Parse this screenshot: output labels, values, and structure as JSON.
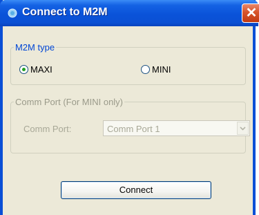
{
  "window": {
    "title": "Connect to M2M",
    "close_symbol": "✕",
    "title_icon": "app-icon"
  },
  "m2m_type": {
    "legend": "M2M type",
    "options": [
      {
        "label": "MAXI",
        "selected": true
      },
      {
        "label": "MINI",
        "selected": false
      }
    ]
  },
  "comm_port": {
    "legend": "Comm Port (For MINI only)",
    "label": "Comm Port:",
    "value": "Comm Port 1",
    "enabled": false
  },
  "actions": {
    "connect_label": "Connect"
  },
  "colors": {
    "titlebar": "#0a53d9",
    "group_legend": "#0046d5",
    "disabled_text": "#a8a897",
    "dialog_bg": "#ece9d8"
  }
}
